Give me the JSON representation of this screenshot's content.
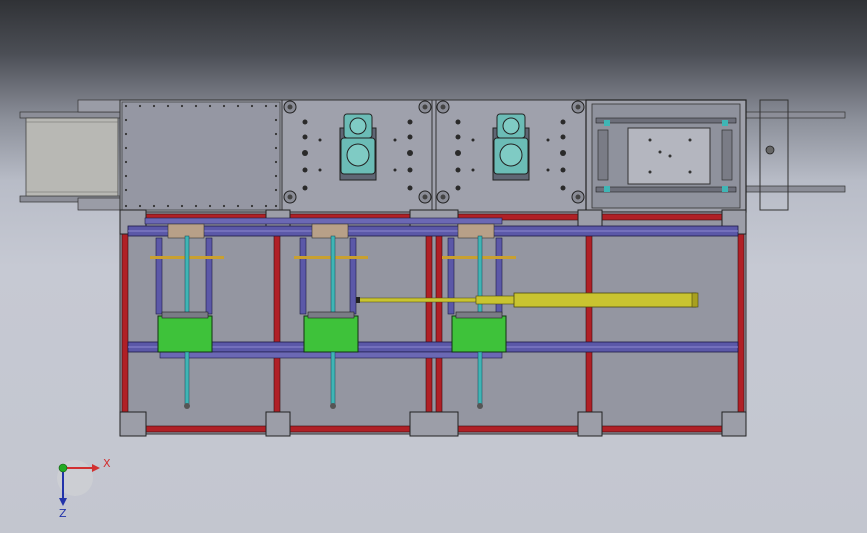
{
  "triad": {
    "x_label": "X",
    "z_label": "Z"
  },
  "colors": {
    "frame_red": "#b02026",
    "rail_blue": "#5b58a8",
    "block_green": "#3ec23a",
    "cylinder_yellow": "#c9c430",
    "rod_cyan": "#3fb5b5",
    "motor_teal": "#6bbcb6",
    "plate_gray": "#a8aab5",
    "triad_red": "#d23030",
    "triad_blue": "#2233aa",
    "triad_green": "#22aa22"
  }
}
